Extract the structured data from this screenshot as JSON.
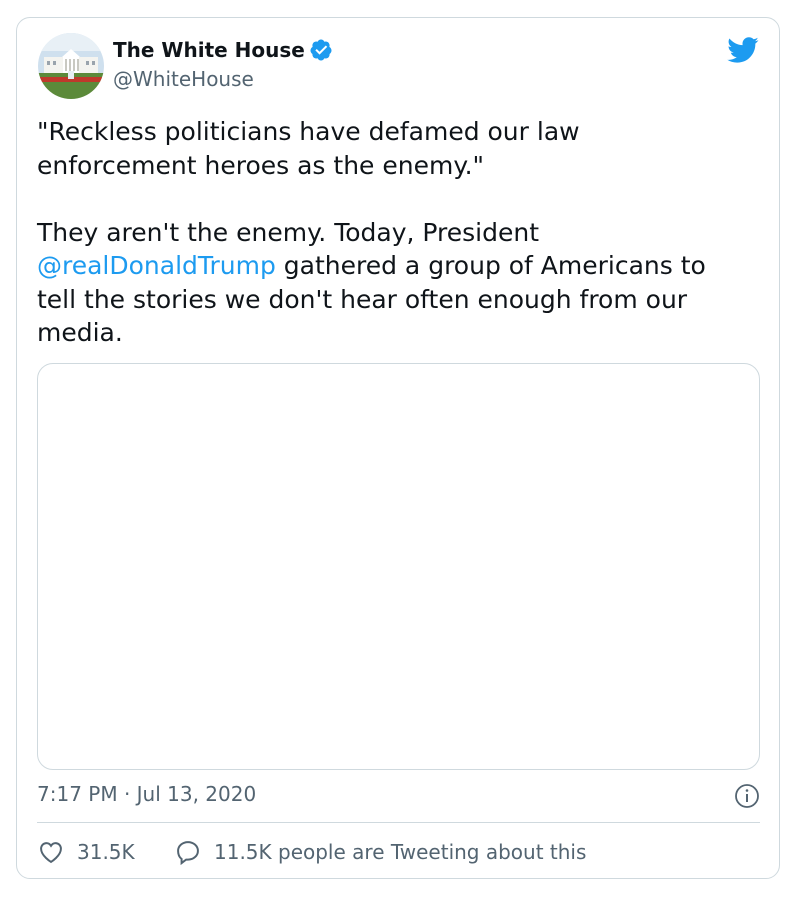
{
  "tweet": {
    "author": {
      "display_name": "The White House",
      "handle": "@WhiteHouse",
      "verified": true
    },
    "text_line_1": "\"Reckless politicians have defamed our law\nenforcement heroes as the enemy.\"",
    "text_line_2_prefix": "They aren't the enemy. Today, President\n",
    "mention": "@realDonaldTrump",
    "text_line_2_suffix": " gathered a group of Americans to\ntell the stories we don't hear often enough from our\nmedia.",
    "timestamp": "7:17 PM · Jul 13, 2020",
    "likes": "31.5K",
    "tweeting_about": "11.5K people are Tweeting about this"
  },
  "icons": {
    "brand": "twitter-bird-icon",
    "verified": "verified-badge-icon",
    "info": "info-icon",
    "like": "heart-icon",
    "reply": "speech-bubble-icon"
  },
  "colors": {
    "accent": "#1d9bf0",
    "text": "#0f1419",
    "muted": "#536471",
    "border": "#cfd9de"
  }
}
